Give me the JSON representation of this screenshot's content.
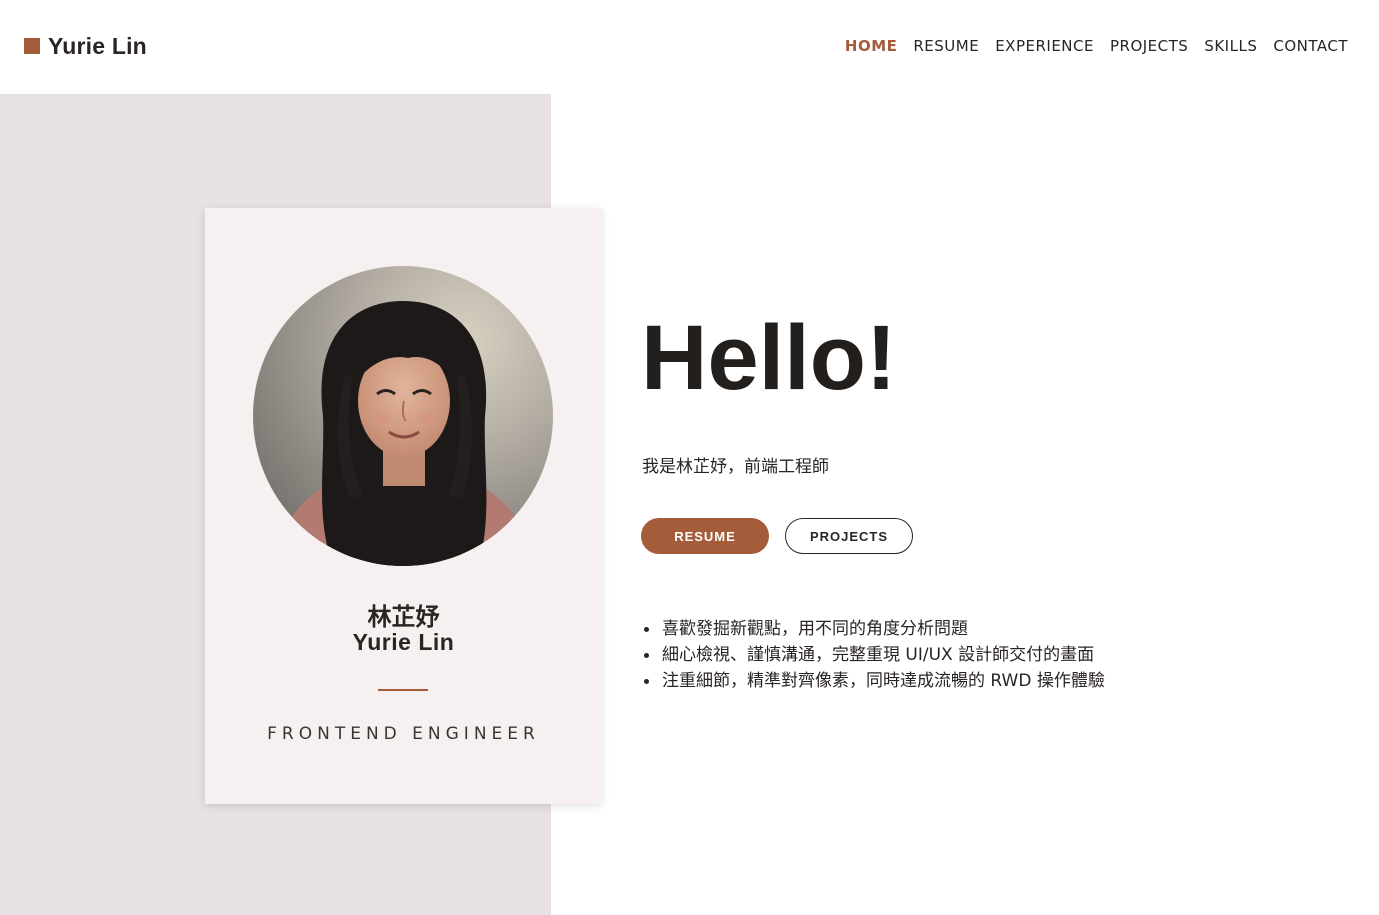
{
  "brand": {
    "name": "Yurie Lin",
    "accent_color": "#a45c3b",
    "logo_icon": "square-icon"
  },
  "nav": {
    "items": [
      {
        "label": "HOME",
        "active": true
      },
      {
        "label": "RESUME",
        "active": false
      },
      {
        "label": "EXPERIENCE",
        "active": false
      },
      {
        "label": "PROJECTS",
        "active": false
      },
      {
        "label": "SKILLS",
        "active": false
      },
      {
        "label": "CONTACT",
        "active": false
      }
    ]
  },
  "profile_card": {
    "photo_alt": "portrait-photo",
    "name_zh": "林芷妤",
    "name_en": "Yurie Lin",
    "role": "FRONTEND ENGINEER"
  },
  "hero": {
    "greeting": "Hello!",
    "intro": "我是林芷妤，前端工程師",
    "buttons": {
      "resume": "RESUME",
      "projects": "PROJECTS"
    },
    "features": [
      "喜歡發掘新觀點，用不同的角度分析問題",
      "細心檢視、謹慎溝通，完整重現 UI/UX 設計師交付的畫面",
      "注重細節，精準對齊像素，同時達成流暢的 RWD 操作體驗"
    ]
  },
  "colors": {
    "left_panel": "#e7e1e1",
    "card": "#f6f1f0",
    "text": "#2a2523"
  }
}
